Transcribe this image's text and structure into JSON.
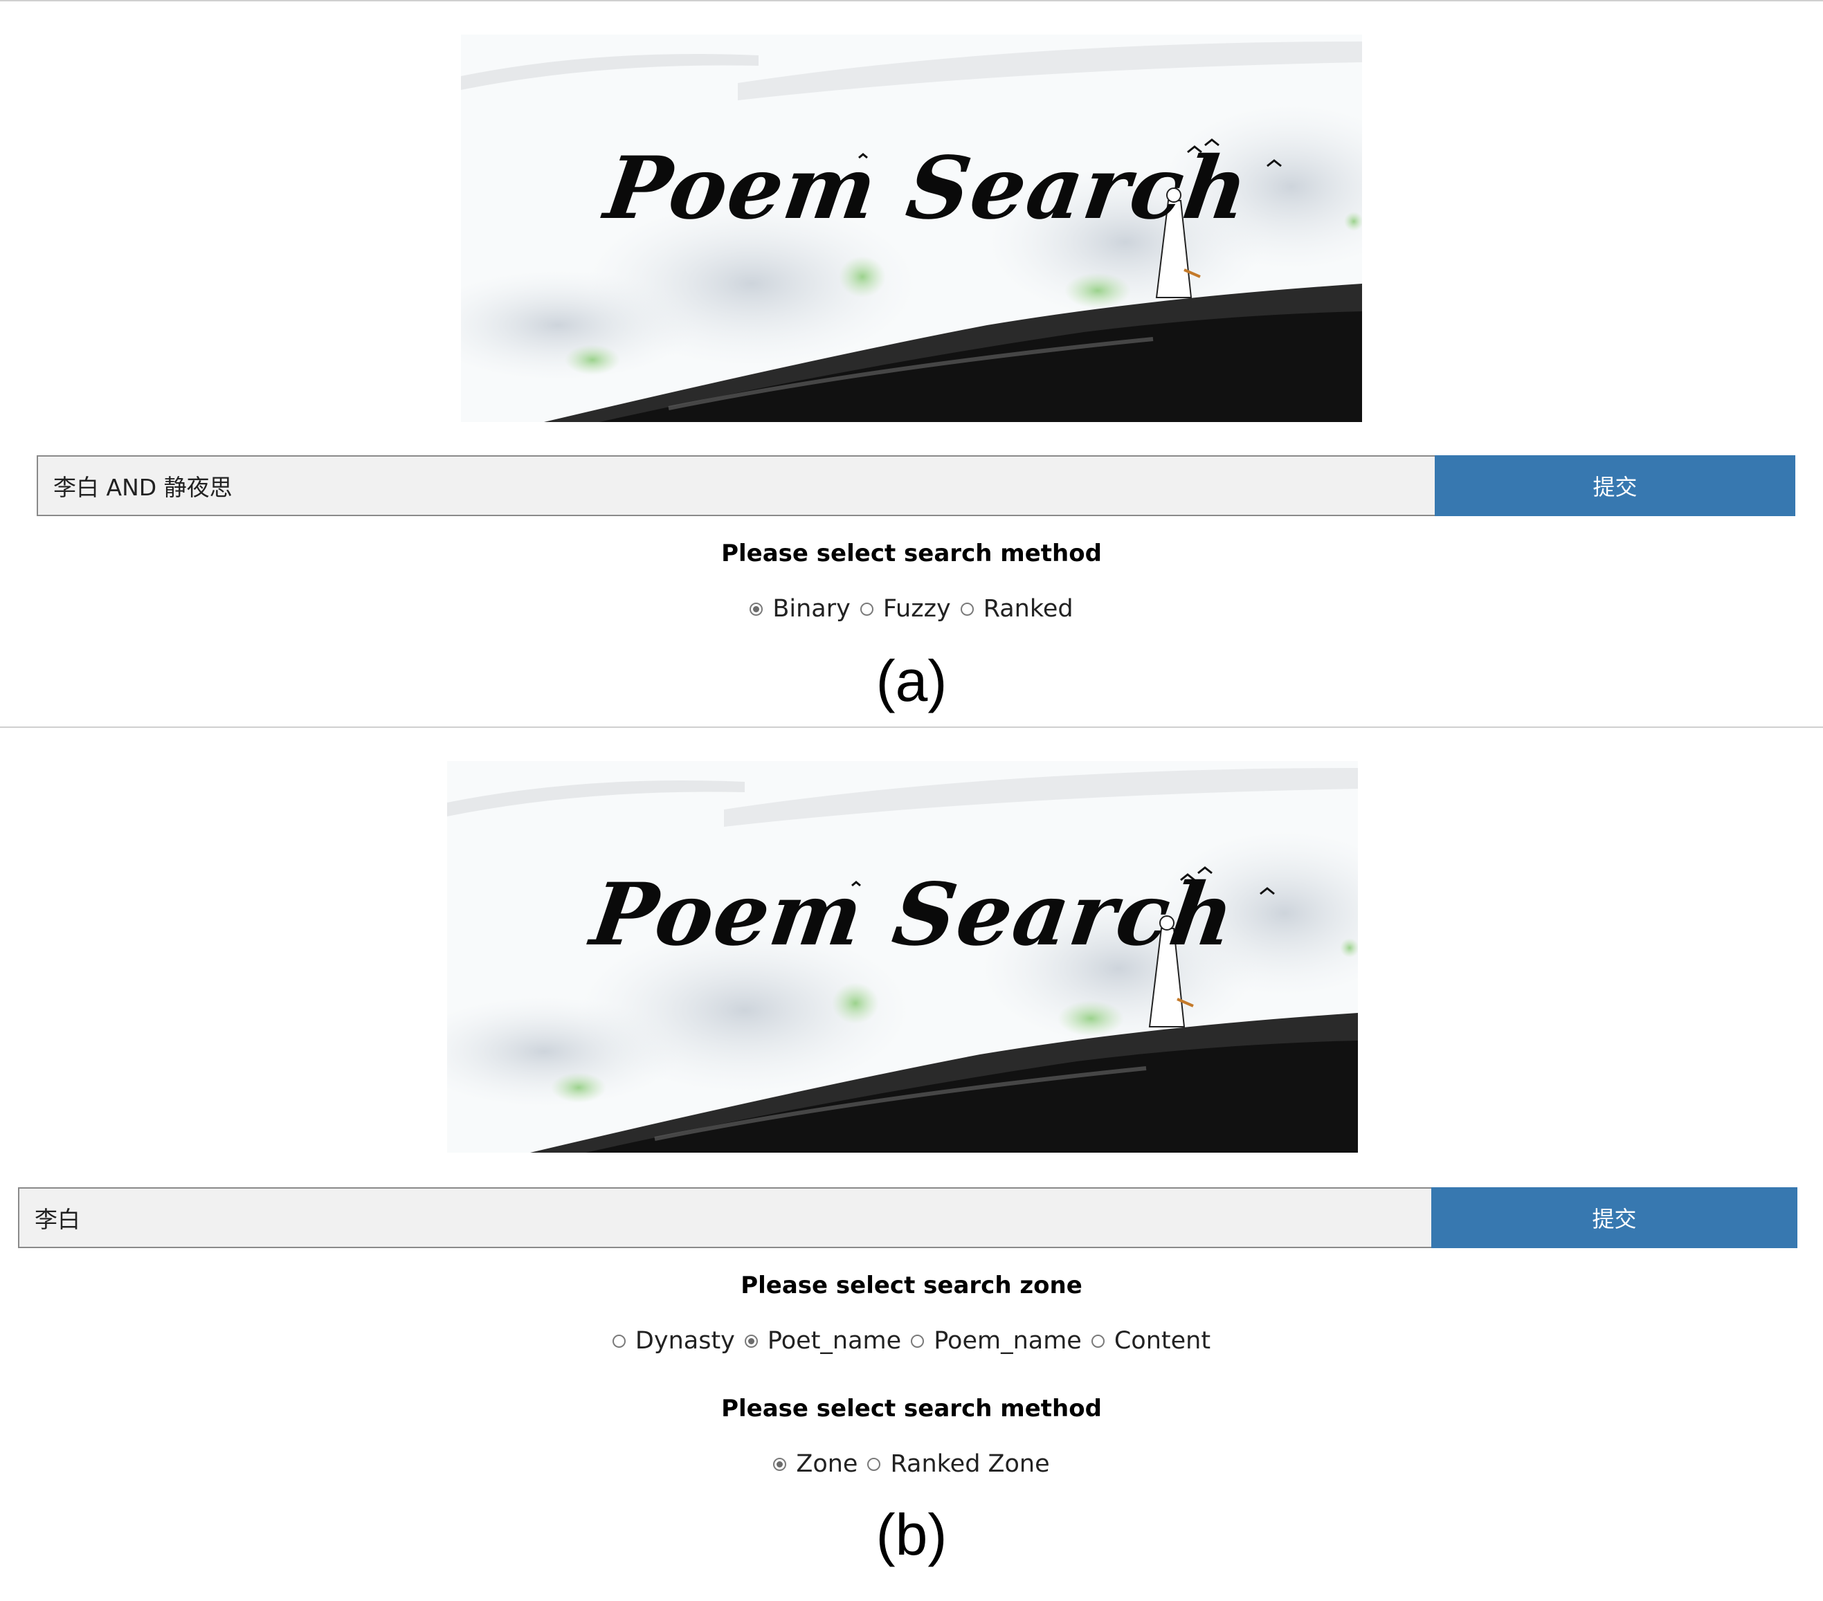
{
  "panel_a": {
    "banner": {
      "title": "Poem Search"
    },
    "search": {
      "value": "李白 AND 静夜思",
      "submit_label": "提交"
    },
    "method": {
      "heading": "Please select search method",
      "options": [
        {
          "label": "Binary",
          "checked": true
        },
        {
          "label": "Fuzzy",
          "checked": false
        },
        {
          "label": "Ranked",
          "checked": false
        }
      ]
    },
    "caption": "(a)"
  },
  "panel_b": {
    "banner": {
      "title": "Poem Search"
    },
    "search": {
      "value": "李白",
      "submit_label": "提交"
    },
    "zone": {
      "heading": "Please select search zone",
      "options": [
        {
          "label": "Dynasty",
          "checked": false
        },
        {
          "label": "Poet_name",
          "checked": true
        },
        {
          "label": "Poem_name",
          "checked": false
        },
        {
          "label": "Content",
          "checked": false
        }
      ]
    },
    "method": {
      "heading": "Please select search method",
      "options": [
        {
          "label": "Zone",
          "checked": true
        },
        {
          "label": "Ranked Zone",
          "checked": false
        }
      ]
    },
    "caption": "(b)"
  },
  "colors": {
    "submit_button": "#3778b0",
    "input_background": "#f1f1f1"
  }
}
